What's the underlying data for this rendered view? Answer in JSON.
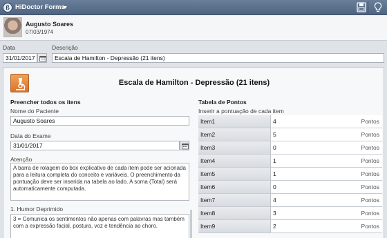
{
  "app": {
    "title": "HiDoctor Forms"
  },
  "patient": {
    "name": "Augusto Soares",
    "dob": "07/03/1974"
  },
  "header_fields": {
    "date_label": "Data",
    "date_value": "31/01/2017",
    "description_label": "Descrição",
    "description_value": "Escala de Hamilton - Depressão (21 itens)"
  },
  "form": {
    "title": "Escala de Hamilton - Depressão (21 itens)",
    "left": {
      "section_title": "Preencher todos os itens",
      "patient_name_label": "Nome do Paciente",
      "patient_name_value": "Augusto Soares",
      "exam_date_label": "Data do Exame",
      "exam_date_value": "31/01/2017",
      "attention_label": "Atenção",
      "attention_text": "A barra de rolagem do box explicativo de cada item pode ser acionada para a leitura completa do conceito e variáveis. O preenchimento da pontuação deve ser inserida na tabela ao lado. A soma (Total) será automaticamente computada.",
      "item1_label": "1. Humor Deprimido",
      "item1_text": "3 = Comunica os sentimentos não apenas com palavras mas também com a expressão facial, postura, voz e tendência ao choro."
    },
    "right": {
      "section_title": "Tabela de Pontos",
      "hint": "Inserir a pontuação de cada item",
      "unit": "Pontos",
      "rows": [
        {
          "item": "Item1",
          "value": "4"
        },
        {
          "item": "Item2",
          "value": "5"
        },
        {
          "item": "Item3",
          "value": "0"
        },
        {
          "item": "Item4",
          "value": "1"
        },
        {
          "item": "Item5",
          "value": "1"
        },
        {
          "item": "Item6",
          "value": "0"
        },
        {
          "item": "Item7",
          "value": "4"
        },
        {
          "item": "Item8",
          "value": "3"
        },
        {
          "item": "Item9",
          "value": "2"
        }
      ]
    }
  }
}
